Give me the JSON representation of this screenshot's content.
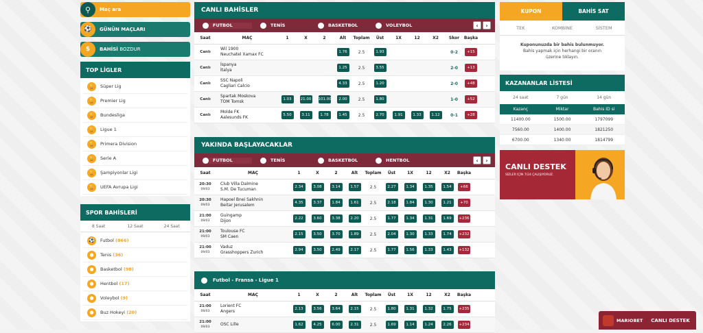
{
  "left": {
    "search_label": "Maç ara",
    "gunun_label": "GÜNÜN MAÇLARI",
    "bahis_label_bold": "BAHİSİ",
    "bahis_label_rest": "BOZDUR",
    "top_ligler_title": "TOP LİGLER",
    "leagues": [
      "Süper Lig",
      "Premier Lig",
      "Bundesliga",
      "Ligue 1",
      "Primera Division",
      "Serie A",
      "Şampiyonlar Ligi",
      "UEFA Avrupa Ligi"
    ],
    "spor_title": "SPOR BAHİSLERİ",
    "spor_tabs": [
      "8 Saat",
      "12 Saat",
      "24 Saat"
    ],
    "sports": [
      {
        "name": "Futbol",
        "count": "(866)"
      },
      {
        "name": "Tenis",
        "count": "(36)"
      },
      {
        "name": "Basketbol",
        "count": "(98)"
      },
      {
        "name": "Hentbol",
        "count": "(17)"
      },
      {
        "name": "Voleybol",
        "count": "(9)"
      },
      {
        "name": "Buz Hokeyi",
        "count": "(20)"
      }
    ]
  },
  "canli": {
    "title": "CANLI BAHİSLER",
    "sports": [
      "FUTBOL",
      "TENİS",
      "BASKETBOL",
      "VOLEYBOL"
    ],
    "cols": [
      "Saat",
      "MAÇ",
      "1",
      "X",
      "2",
      "Alt",
      "Toplam",
      "Üst",
      "1X",
      "12",
      "X2",
      "Skor",
      "Başka"
    ],
    "rows": [
      {
        "saat": "Canlı",
        "t1": "Wil 1900",
        "t2": "Neuchatel Xamax FC",
        "o": [
          "",
          "",
          "",
          "1.76",
          "2.5",
          "1.93",
          "",
          "",
          ""
        ],
        "skor": "0-2",
        "plus": "+15"
      },
      {
        "saat": "Canlı",
        "t1": "İspanya",
        "t2": "İtalya",
        "o": [
          "",
          "",
          "",
          "1.25",
          "2.5",
          "3.55",
          "",
          "",
          ""
        ],
        "skor": "2-0",
        "plus": "+13"
      },
      {
        "saat": "Canlı",
        "t1": "SSC Napoli",
        "t2": "Cagliari Calcio",
        "o": [
          "",
          "",
          "",
          "4.33",
          "2.5",
          "1.20",
          "",
          "",
          ""
        ],
        "skor": "2-0",
        "plus": "+48"
      },
      {
        "saat": "Canlı",
        "t1": "Spartak Moskova",
        "t2": "TOM Tomsk",
        "o": [
          "1.03",
          "21.00",
          "101.00",
          "2.00",
          "2.5",
          "1.80",
          "",
          "",
          ""
        ],
        "skor": "1-0",
        "plus": "+52"
      },
      {
        "saat": "Canlı",
        "t1": "Molde FK",
        "t2": "Aalesunds FK",
        "o": [
          "5.50",
          "3.11",
          "1.78",
          "1.45",
          "2.5",
          "2.70",
          "1.91",
          "1.33",
          "1.12"
        ],
        "skor": "0-1",
        "plus": "+28"
      }
    ]
  },
  "yakinda": {
    "title": "YAKINDA BAŞLAYACAKLAR",
    "sports": [
      "FUTBOL",
      "TENİS",
      "BASKETBOL",
      "HENTBOL"
    ],
    "cols": [
      "Saat",
      "MAÇ",
      "1",
      "X",
      "2",
      "Alt",
      "Toplam",
      "Üst",
      "1X",
      "12",
      "X2",
      "Başka"
    ],
    "rows": [
      {
        "saat": "20:30",
        "tarih": "09/03",
        "t1": "Club Villa Dalmine",
        "t2": "S.M. De Tucuman",
        "o": [
          "2.34",
          "3.08",
          "3.14",
          "1.57",
          "2.5",
          "2.27",
          "1.34",
          "1.35",
          "1.54"
        ],
        "plus": "+66"
      },
      {
        "saat": "20:30",
        "tarih": "09/03",
        "t1": "Hapoel Bnei Sakhnin",
        "t2": "Beitar Jerusalem",
        "o": [
          "4.35",
          "3.37",
          "1.84",
          "1.61",
          "2.5",
          "2.18",
          "1.84",
          "1.30",
          "1.21"
        ],
        "plus": "+70"
      },
      {
        "saat": "21:00",
        "tarih": "09/03",
        "t1": "Guingamp",
        "t2": "Dijon",
        "o": [
          "2.22",
          "3.60",
          "3.38",
          "2.20",
          "2.5",
          "1.77",
          "1.34",
          "1.31",
          "1.69"
        ],
        "plus": "+236"
      },
      {
        "saat": "21:00",
        "tarih": "09/03",
        "t1": "Toulouse FC",
        "t2": "SM Caen",
        "o": [
          "2.15",
          "3.50",
          "3.70",
          "1.89",
          "2.5",
          "2.04",
          "1.30",
          "1.33",
          "1.74"
        ],
        "plus": "+232"
      },
      {
        "saat": "21:00",
        "tarih": "09/03",
        "t1": "Vaduz",
        "t2": "Grasshoppers Zurich",
        "o": [
          "2.94",
          "3.50",
          "2.49",
          "2.17",
          "2.5",
          "1.77",
          "1.56",
          "1.33",
          "1.43"
        ],
        "plus": "+132"
      }
    ]
  },
  "ligue": {
    "title": "Futbol - Fransa - Ligue 1",
    "cols": [
      "Saat",
      "MAÇ",
      "1",
      "X",
      "2",
      "Alt",
      "Toplam",
      "Üst",
      "1X",
      "12",
      "X2",
      "Başka"
    ],
    "rows": [
      {
        "saat": "21:00",
        "tarih": "09/03",
        "t1": "Lorient FC",
        "t2": "Angers",
        "o": [
          "2.13",
          "3.56",
          "3.64",
          "2.15",
          "2.5",
          "1.80",
          "1.31",
          "1.32",
          "1.75"
        ],
        "plus": "+235"
      },
      {
        "saat": "21:00",
        "tarih": "09/03",
        "t1": "OSC Lille",
        "t2": "",
        "o": [
          "1.62",
          "4.25",
          "6.00",
          "2.31",
          "2.5",
          "1.69",
          "1.14",
          "1.24",
          "2.26"
        ],
        "plus": "+234"
      }
    ]
  },
  "right": {
    "kupon": "KUPON",
    "bahis_sat": "BAHİS SAT",
    "tabs": [
      "TEK",
      "KOMBİNE",
      "SİSTEM"
    ],
    "msg_bold": "Kuponunuzda bir bahis bulunmuyor.",
    "msg": "Bahis yapmak için herhangi bir oranın üzerine tıklayın.",
    "kazananlar": "KAZANANLAR LİSTESİ",
    "win_tabs": [
      "24 saat",
      "7 gün",
      "14 gün"
    ],
    "win_cols": [
      "Kazanç",
      "Miktar",
      "Bahis ID si"
    ],
    "win_rows": [
      [
        "11400.00",
        "1500.00",
        "1797099"
      ],
      [
        "7560.00",
        "1400.00",
        "1821250"
      ],
      [
        "6700.00",
        "1340.00",
        "1814799"
      ]
    ],
    "promo_title": "CANLI DESTEK",
    "promo_sub": "SİZLER İÇİN 7/24 ÇALIŞIYORUZ."
  },
  "footer": {
    "brand": "MARIOBET",
    "label": "CANLI DESTEK"
  },
  "colors": {
    "green": "#0e6b62",
    "orange": "#f5a623",
    "maroon": "#7e2a3a"
  }
}
